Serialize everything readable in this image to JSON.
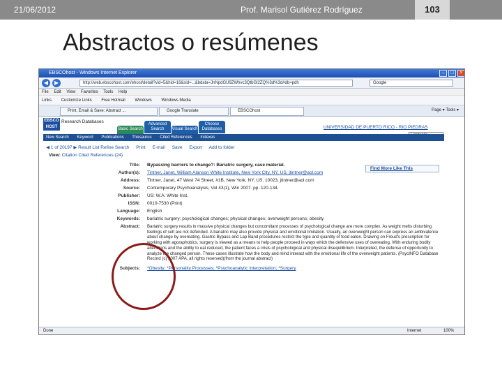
{
  "slide": {
    "date": "21/06/2012",
    "author": "Prof. Marisol Gutiérez Rodríguez",
    "page_number": "103",
    "title": "Abstractos o resúmenes"
  },
  "browser": {
    "window_title": "EBSCOhost - Windows Internet Explorer",
    "url": "http://web.ebscohost.com/ehost/detail?vid=5&hid=16&sid=...&bdata=JnNpdGU9ZWhvc3QtbGl2ZQ%3d%3d#db=pdh",
    "search_value": "Google",
    "menu_items": [
      "File",
      "Edit",
      "View",
      "Favorites",
      "Tools",
      "Help"
    ],
    "links": [
      "Links",
      "Customize Links",
      "Free Hotmail",
      "Windows",
      "Windows Media"
    ],
    "tabs": [
      "Print, Email & Save: Abstract ...",
      "Google Translate",
      "EBSCOhost"
    ],
    "tools_label": "Page ▾  Tools ▾",
    "status_text": "Done",
    "status_zone": "Internet",
    "status_zoom": "100%"
  },
  "ebsco": {
    "logo": "EBSCO HOST",
    "logo_text": "Research Databases",
    "search_tabs": [
      "Basic Search",
      "Advanced Search",
      "Visual Search",
      "Choose Databases"
    ],
    "university": "UNIVERSIDAD DE PUERTO RICO - RIO PIEDRAS",
    "language": "Language",
    "nav_items": [
      "New Search",
      "Keyword",
      "Publications",
      "Thesaurus",
      "Cited References",
      "Indexes"
    ],
    "record_nav": "◀ 1 of 20197 ▶  Result List  Refine Search",
    "tool_items": [
      "Print",
      "E-mail",
      "Save",
      "Export",
      "Add to folder"
    ],
    "view_label": "View:",
    "view_options": "Citation  Cited References (24)",
    "find_more": "Find More Like This",
    "record": [
      {
        "label": "Title:",
        "value": "Bypassing barriers to change?: Bariatric surgery, case material.",
        "style": "title"
      },
      {
        "label": "Author(s):",
        "value": "Tintner, Janet, William Alanson White Institute, New York City, NY, US, jtintner@aol.com",
        "style": "link"
      },
      {
        "label": "Address:",
        "value": "Tintner, Janet, 47 West 74 Street, #1B, New York, NY, US, 10023, jtintner@aol.com",
        "style": "plain"
      },
      {
        "label": "Source:",
        "value": "Contemporary Psychoanalysis, Vol 43(1), Win 2007. pp. 120-134.",
        "style": "plain"
      },
      {
        "label": "Publisher:",
        "value": "US: W.A. White Inst.",
        "style": "plain"
      },
      {
        "label": "ISSN:",
        "value": "0010-7530 (Print)",
        "style": "plain"
      },
      {
        "label": "Language:",
        "value": "English",
        "style": "plain"
      },
      {
        "label": "Keywords:",
        "value": "bariatric surgery; psychological changes; physical changes; overweight persons; obesity",
        "style": "plain"
      },
      {
        "label": "Abstract:",
        "value": "Bariatric surgery results in massive physical changes but concomitant processes of psychological change are more complex. As weight melts disturbing feelings of self are not defended. A bariatric may also provide physical and emotional limitation. Usually, an overweight person can express an ambivalence about change by overeating. Gastric Bypass and Lap Band procedures restrict the type and quantity of food eaten. Drawing on Freud's prescription for working with agoraphobics, surgery is viewed as a means to help people proceed in ways which the defensive uses of overeating. With enduring bodily alterations and the ability to eat reduced, the patient faces a crisis of psychological and physical disequilibrium. Interpreted, the defense of opportunity to analyze the changed person. These cases illustrate how the body and mind interact with the emotional life of the overweight patients. (PsycINFO Database Record (c) 2007 APA, all rights reserved)(from the journal abstract)",
        "style": "plain"
      },
      {
        "label": "Subjects:",
        "value": "*Obesity; *Personality Processes; *Psychoanalytic Interpretation; *Surgery",
        "style": "link"
      }
    ]
  },
  "colors": {
    "header_bar": "#8a8a8a",
    "ebsco_blue": "#1d4f93",
    "annotation_circle": "#8b1a1a"
  }
}
